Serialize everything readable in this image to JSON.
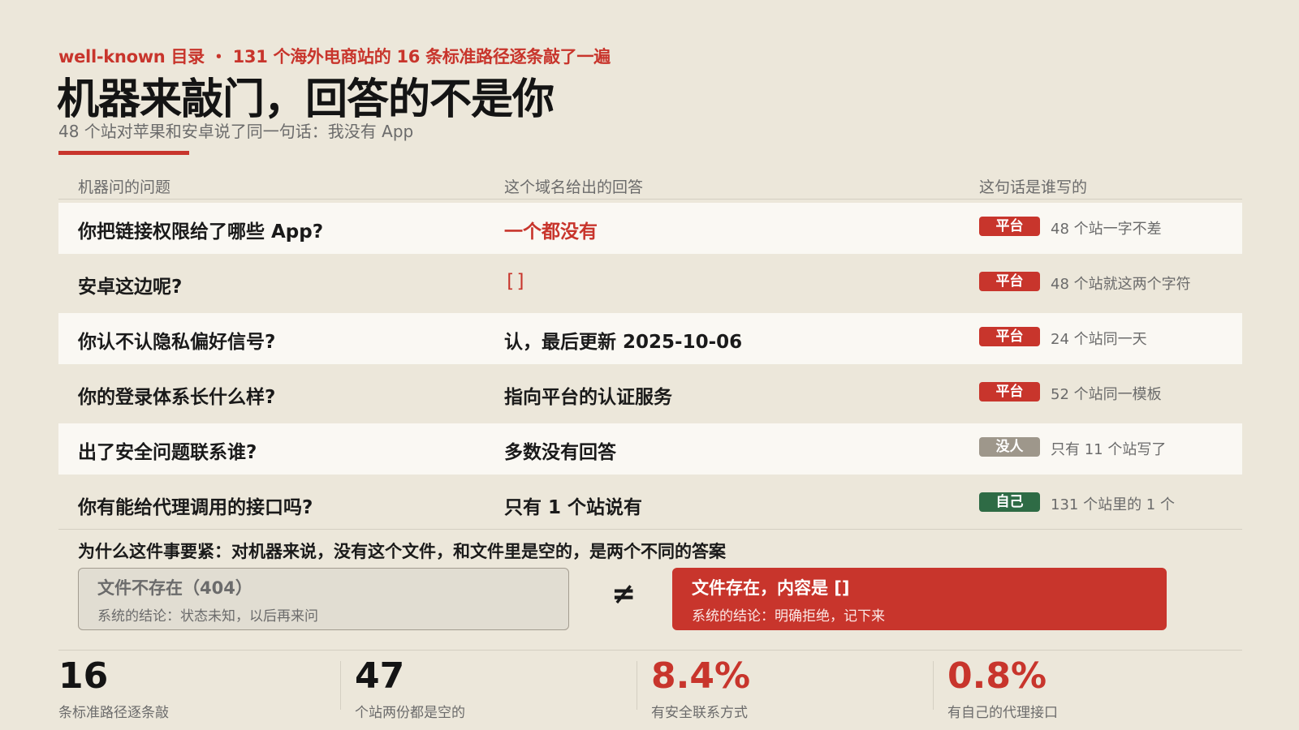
{
  "header": {
    "kicker": "well-known 目录 ・ 131 个海外电商站的 16 条标准路径逐条敲了一遍",
    "title": "机器来敲门，回答的不是你",
    "subtitle": "48 个站对苹果和安卓说了同一句话：我没有 App"
  },
  "table": {
    "headers": {
      "question": "机器问的问题",
      "answer": "这个域名给出的回答",
      "who": "这句话是谁写的"
    },
    "rows": [
      {
        "question": "你把链接权限给了哪些 App?",
        "answer": "一个都没有",
        "badge": "平台",
        "note": "48 个站一字不差"
      },
      {
        "question": "安卓这边呢?",
        "answer": "[]",
        "badge": "平台",
        "note": "48 个站就这两个字符"
      },
      {
        "question": "你认不认隐私偏好信号?",
        "answer": "认，最后更新 2025-10-06",
        "badge": "平台",
        "note": "24 个站同一天"
      },
      {
        "question": "你的登录体系长什么样?",
        "answer": "指向平台的认证服务",
        "badge": "平台",
        "note": "52 个站同一模板"
      },
      {
        "question": "出了安全问题联系谁?",
        "answer": "多数没有回答",
        "badge": "没人",
        "note": "只有 11 个站写了"
      },
      {
        "question": "你有能给代理调用的接口吗?",
        "answer": "只有 1 个站说有",
        "badge": "自己",
        "note": "131 个站里的 1 个"
      }
    ]
  },
  "why": {
    "heading": "为什么这件事要紧：对机器来说，没有这个文件，和文件里是空的，是两个不同的答案",
    "left": {
      "title": "文件不存在（404）",
      "sub": "系统的结论：状态未知，以后再来问"
    },
    "symbol": "≠",
    "right": {
      "title": "文件存在，内容是 []",
      "sub": "系统的结论：明确拒绝，记下来"
    }
  },
  "stats": [
    {
      "value": "16",
      "label": "条标准路径逐条敲"
    },
    {
      "value": "47",
      "label": "个站两份都是空的"
    },
    {
      "value": "8.4%",
      "label": "有安全联系方式"
    },
    {
      "value": "0.8%",
      "label": "有自己的代理接口"
    }
  ],
  "colors": {
    "accent_red": "#c8352c",
    "badge_grey": "#9e978b",
    "badge_green": "#2e6b45",
    "background": "#ece7da"
  }
}
